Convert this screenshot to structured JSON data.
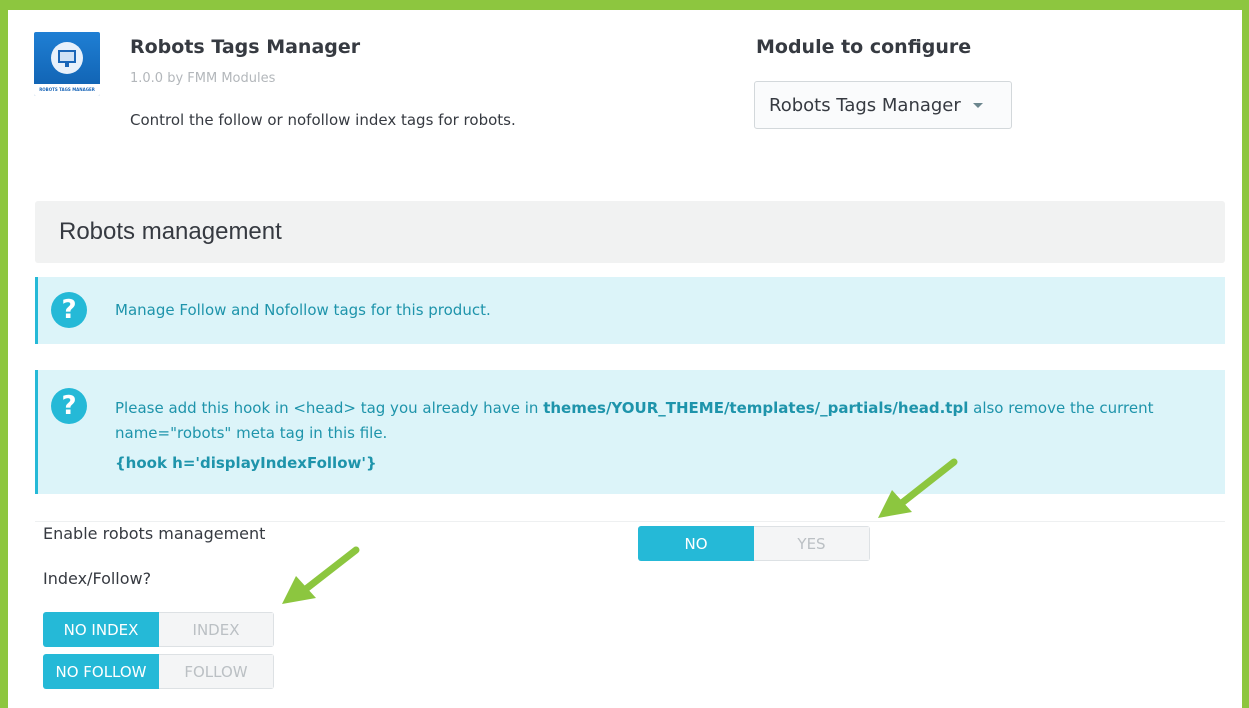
{
  "module": {
    "thumbnail_caption": "ROBOTS TAGS MANAGER",
    "name": "Robots Tags Manager",
    "version": "1.0.0 by FMM Modules",
    "description": "Control the follow or nofollow index tags for robots."
  },
  "configure": {
    "title": "Module to configure",
    "selected": "Robots Tags Manager"
  },
  "panel": {
    "title": "Robots management"
  },
  "alerts": {
    "first": "Manage Follow and Nofollow tags for this product.",
    "second_pre": "Please add this hook in <head> tag you already have in ",
    "second_path": "themes/YOUR_THEME/templates/_partials/head.tpl",
    "second_post": " also remove the current name=\"robots\" meta tag in this file.",
    "second_hook": "{hook h='displayIndexFollow'}"
  },
  "settings": {
    "enable_label": "Enable robots management",
    "enable_no": "NO",
    "enable_yes": "YES",
    "index_follow_label": "Index/Follow?",
    "no_index": "NO INDEX",
    "index": "INDEX",
    "no_follow": "NO FOLLOW",
    "follow": "FOLLOW"
  },
  "colors": {
    "frame": "#8dc63f",
    "accent": "#25b9d7",
    "alert_bg": "#dcf4f9",
    "arrow": "#8cc63f"
  },
  "icons": [
    "question-circle-icon",
    "caret-down-icon",
    "arrow-annotation-icon"
  ]
}
